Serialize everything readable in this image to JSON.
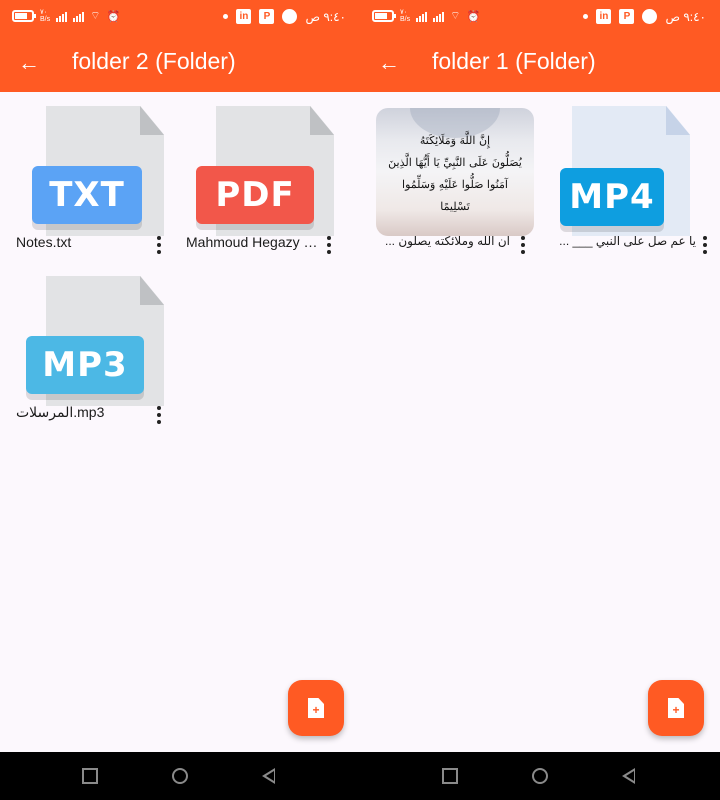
{
  "status_bar": {
    "time": "٩:٤٠ ص",
    "net_speed": "٧٠\nB/s"
  },
  "screens": [
    {
      "title": "folder 2 (Folder)",
      "files": [
        {
          "name": "Notes.txt",
          "type_label": "TXT",
          "color": "#5BA3F5"
        },
        {
          "name": "Mahmoud Hegazy CV.pdf",
          "type_label": "PDF",
          "color": "#F2574A"
        },
        {
          "name": "المرسلات.mp3",
          "type_label": "MP3",
          "color": "#4CB8E5"
        }
      ]
    },
    {
      "title": "folder 1 (Folder)",
      "files": [
        {
          "name": "ان الله وملائكته يصلون ...",
          "type_label": "",
          "image_text": [
            "إِنَّ اللَّهَ وَمَلَائِكَتَهُ",
            "يُصَلُّونَ عَلَى النَّبِيِّ يَا أَيُّهَا الَّذِينَ",
            "آمَنُوا صَلُّوا عَلَيْهِ وَسَلِّمُوا تَسْلِيمًا"
          ]
        },
        {
          "name": "يا عم صل على النبي ___ ...",
          "type_label": "MP4",
          "color": "#0E9EE0"
        }
      ]
    }
  ],
  "colors": {
    "accent": "#FF5A23",
    "background": "#FCF8FD"
  },
  "icons": {
    "back": "arrow-left-icon",
    "fab": "add-file-icon",
    "menu": "more-vert-icon"
  }
}
